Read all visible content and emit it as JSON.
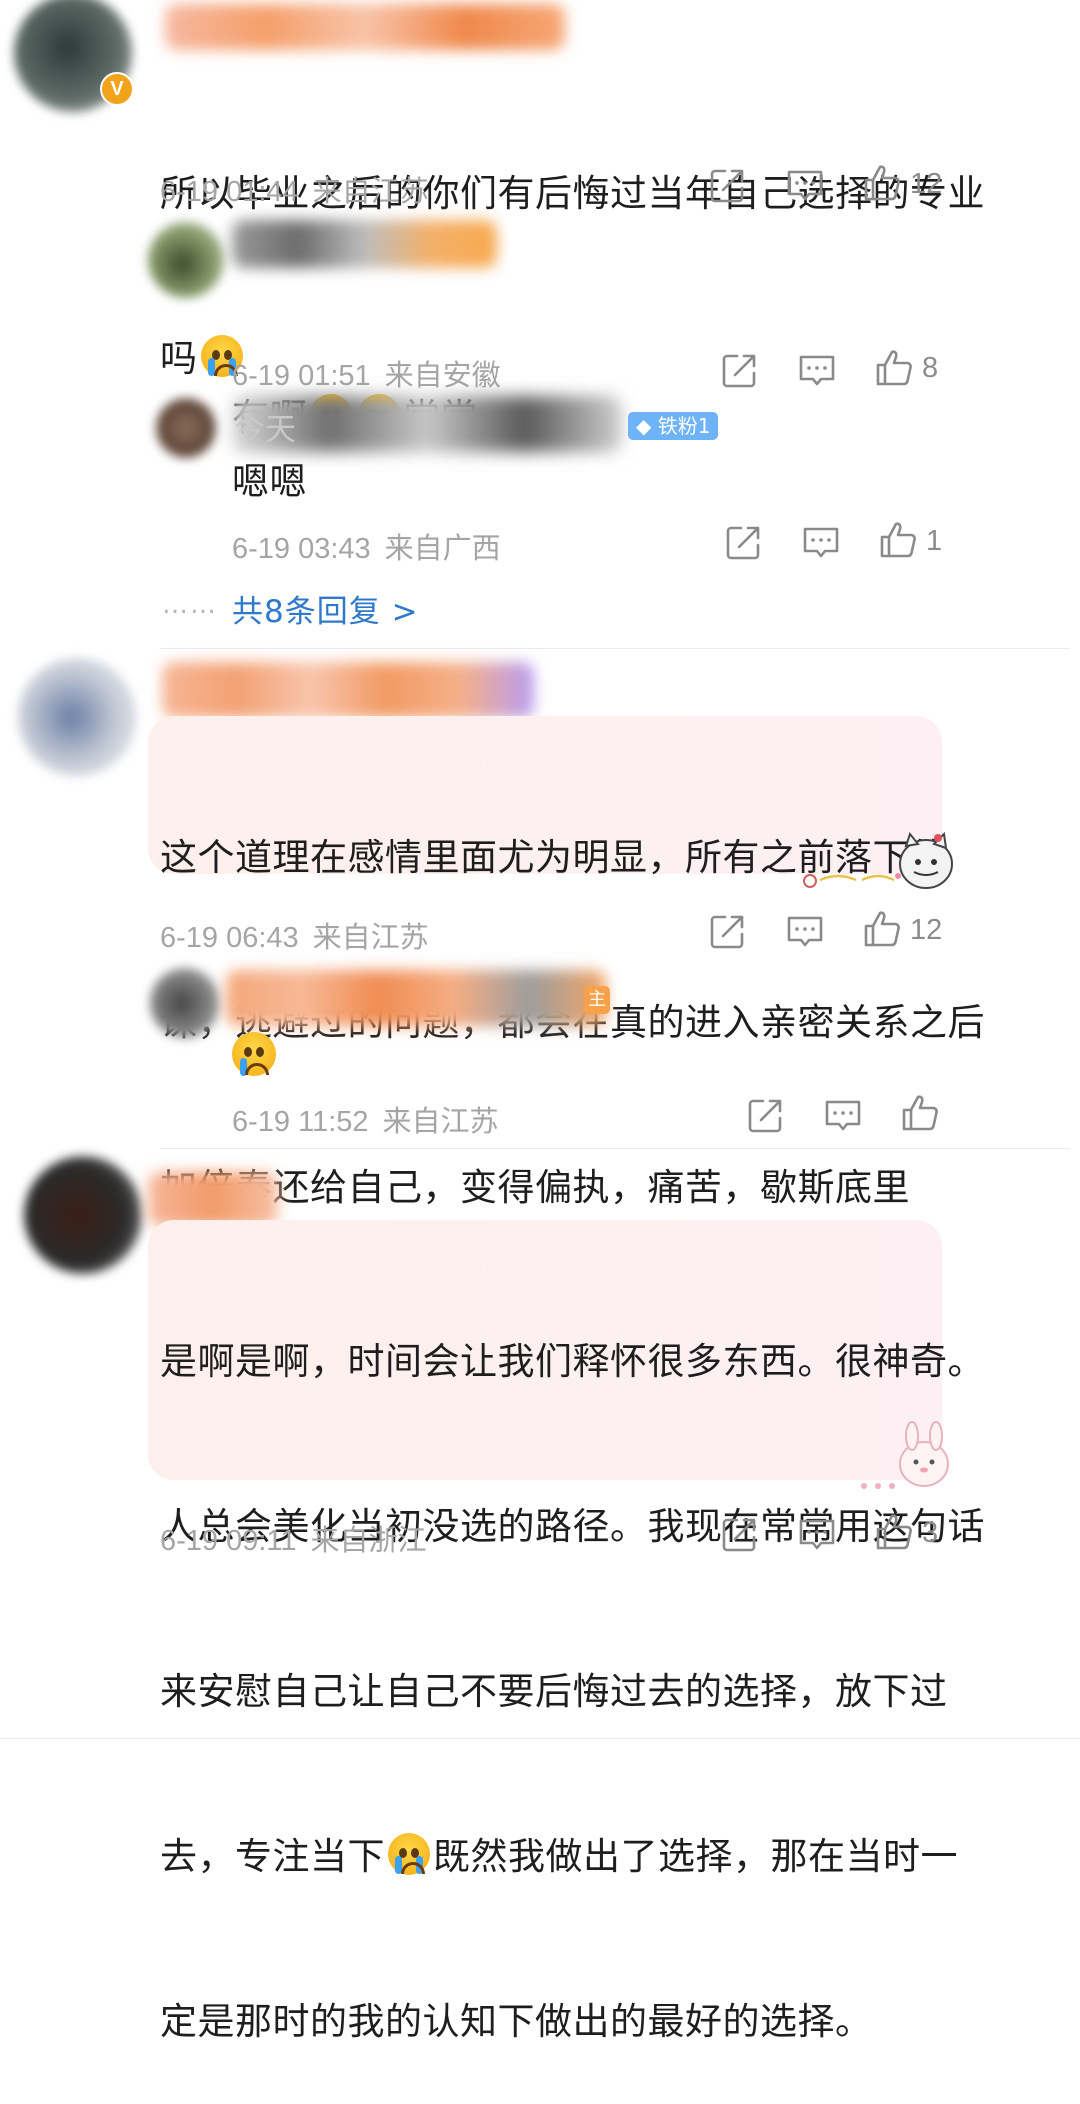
{
  "comments": [
    {
      "text_lines": [
        "所以毕业之后的你们有后悔过当年自己选择的专业",
        "吗"
      ],
      "date": "6-19 01:44",
      "location": "来自江苏",
      "likes": "12"
    },
    {
      "text_before": "有啊",
      "text_after": "常常",
      "date": "6-19 01:51",
      "location": "来自安徽",
      "likes": "8"
    },
    {
      "name_fragment": "今天",
      "badge": "铁粉1",
      "text": "嗯嗯",
      "date": "6-19 03:43",
      "location": "来自广西",
      "likes": "1"
    },
    {
      "text_lines": [
        "这个道理在感情里面尤为明显，所有之前落下的",
        "课，逃避过的问题，都会在真的进入亲密关系之后",
        "加倍奉还给自己，变得偏执，痛苦，歇斯底里"
      ],
      "date": "6-19 06:43",
      "location": "来自江苏",
      "likes": "12"
    },
    {
      "date": "6-19 11:52",
      "location": "来自江苏",
      "likes": ""
    },
    {
      "text_lines": [
        "是啊是啊，时间会让我们释怀很多东西。很神奇。",
        "人总会美化当初没选的路径。我现在常常用这句话",
        "来安慰自己让自己不要后悔过去的选择，放下过"
      ],
      "line4_before": "去，专注当下",
      "line4_after": "既然我做出了选择，那在当时一",
      "line5": "定是那时的我的认知下做出的最好的选择。",
      "date": "6-19 09:11",
      "location": "来自浙江",
      "likes": "3"
    }
  ],
  "more_replies": {
    "dots": "……",
    "label": "共8条回复 >"
  },
  "author_badge": "V",
  "host_badge": "主",
  "icons": {
    "share": "share-icon",
    "comment": "comment-icon",
    "like": "thumbs-up-icon"
  },
  "colors": {
    "link": "#2e79c9",
    "meta": "#a5a5a5",
    "bubble": "#fdf0ec"
  }
}
